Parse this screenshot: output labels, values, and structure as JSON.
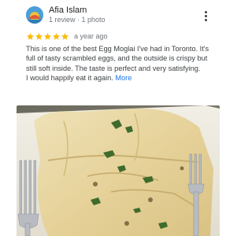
{
  "review": {
    "author_name": "Afia Islam",
    "author_meta": "1 review · 1 photo",
    "rating": 5,
    "rating_max": 5,
    "date": "a year ago",
    "text_paragraph_1": "This is one of the best Egg Moglai I've had in Toronto. It's full of tasty scrambled eggs, and the outside is crispy but still soft inside. The taste is perfect and very satisfying.",
    "text_paragraph_2": "I would happily eat it again.",
    "more_label": "More"
  },
  "colors": {
    "star": "#fbbc04",
    "link": "#1a73e8",
    "avatar_bg": "#4a9fd6"
  },
  "icons": {
    "avatar": "avatar-illustration-icon",
    "menu": "more-vert-icon",
    "star": "star-icon"
  }
}
